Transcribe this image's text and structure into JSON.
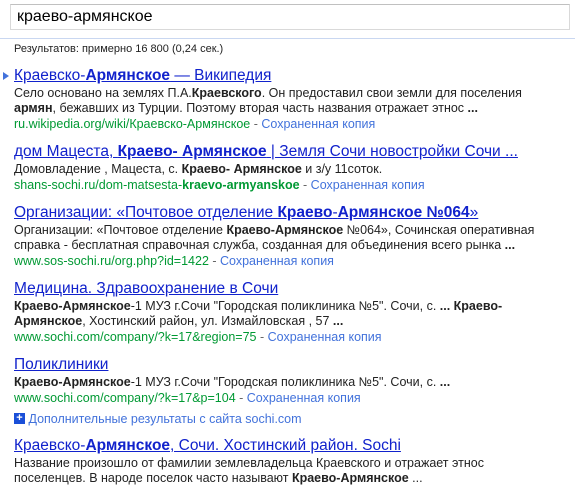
{
  "search": {
    "query": "краево-армянское"
  },
  "stats": "Результатов: примерно 16 800 (0,24 сек.)",
  "results": [
    {
      "title_parts": [
        [
          "Краевско-",
          false
        ],
        [
          "Армянское",
          true
        ],
        [
          " — Википедия",
          false
        ]
      ],
      "snippet_lines": [
        [
          [
            "Село основано на землях П.А.",
            false
          ],
          [
            "Краевского",
            true
          ],
          [
            ". Он предоставил свои земли для поселения",
            false
          ]
        ],
        [
          [
            "армян",
            true
          ],
          [
            ", бежавших из Турции. Поэтому вторая часть названия отражает этнос ",
            false
          ],
          [
            "...",
            true
          ]
        ]
      ],
      "url_parts": [
        [
          "ru.wikipedia.org/wiki/Краевско-Армянское",
          false
        ]
      ],
      "cache": "Сохраненная копия",
      "separator": " - "
    },
    {
      "title_parts": [
        [
          "дом Мацеста, ",
          false
        ],
        [
          "Краево- Армянское",
          true
        ],
        [
          " | Земля Сочи новостройки Сочи ...",
          false
        ]
      ],
      "snippet_lines": [
        [
          [
            "Домовладение , Мацеста, с. ",
            false
          ],
          [
            "Краево- Армянское",
            true
          ],
          [
            " и з/у 11соток.",
            false
          ]
        ]
      ],
      "url_parts": [
        [
          "shans-sochi.ru/dom-matsesta-",
          false
        ],
        [
          "kraevo-armyanskoe",
          true
        ]
      ],
      "cache": "Сохраненная копия",
      "separator": " - "
    },
    {
      "title_parts": [
        [
          "Организации: «Почтовое отделение ",
          false
        ],
        [
          "Краево",
          true
        ],
        [
          "-",
          false
        ],
        [
          "Армянское №064",
          true
        ],
        [
          "»",
          false
        ]
      ],
      "snippet_lines": [
        [
          [
            "Организации: «Почтовое отделение ",
            false
          ],
          [
            "Краево-Армянское",
            true
          ],
          [
            " №064», Сочинская оперативная",
            false
          ]
        ],
        [
          [
            "справка - бесплатная справочная служба, созданная для объединения всего рынка ",
            false
          ],
          [
            "...",
            true
          ]
        ]
      ],
      "url_parts": [
        [
          "www.sos-sochi.ru/org.php?id=1422",
          false
        ]
      ],
      "cache": "Сохраненная копия",
      "separator": " - "
    },
    {
      "title_parts": [
        [
          "Медицина. Здравоохранение в Сочи",
          false
        ]
      ],
      "snippet_lines": [
        [
          [
            "Краево-Армянское",
            true
          ],
          [
            "-1 МУЗ г.Сочи \"Городская поликлиника №5\". Сочи, с. ",
            false
          ],
          [
            "... Краево-",
            true
          ]
        ],
        [
          [
            "Армянское",
            true
          ],
          [
            ", Хостинский район, ул. Измайловская , 57 ",
            false
          ],
          [
            "...",
            true
          ]
        ]
      ],
      "url_parts": [
        [
          "www.sochi.com/company/?k=17&region=75",
          false
        ]
      ],
      "cache": "Сохраненная копия",
      "separator": " - "
    },
    {
      "title_parts": [
        [
          "Поликлиники",
          false
        ]
      ],
      "snippet_lines": [
        [
          [
            "Краево-Армянское",
            true
          ],
          [
            "-1 МУЗ г.Сочи \"Городская поликлиника №5\". Сочи, с. ",
            false
          ],
          [
            "...",
            true
          ]
        ]
      ],
      "url_parts": [
        [
          "www.sochi.com/company/?k=17&p=104",
          false
        ]
      ],
      "cache": "Сохраненная копия",
      "separator": " - "
    }
  ],
  "more_from_site": "Дополнительные результаты с сайта sochi.com",
  "last_result": {
    "title_parts": [
      [
        "Краевско-",
        false
      ],
      [
        "Армянское",
        true
      ],
      [
        ", Сочи. Хостинский район. Sochi",
        false
      ]
    ],
    "snippet_lines": [
      [
        [
          "Название произошло от фамилии землевладельца Краевского и отражает этнос",
          false
        ]
      ],
      [
        [
          "поселенцев. В народе поселок часто называют ",
          false
        ],
        [
          "Краево-Армянское",
          true
        ],
        [
          " ...",
          false
        ]
      ]
    ]
  }
}
